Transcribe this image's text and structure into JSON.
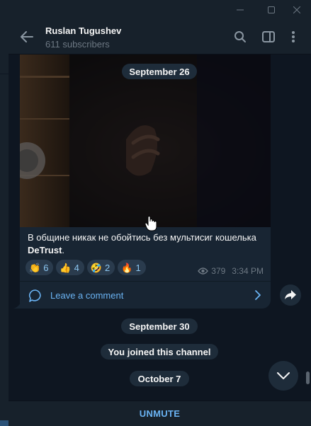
{
  "window": {
    "minimize_icon": "minimize-icon",
    "maximize_icon": "maximize-icon",
    "close_icon": "close-icon"
  },
  "header": {
    "title": "Ruslan Tugushev",
    "subtitle": "611 subscribers",
    "back_icon": "arrow-left-icon",
    "search_icon": "search-icon",
    "sidebar_icon": "sidebar-toggle-icon",
    "more_icon": "more-vertical-icon"
  },
  "chat": {
    "date_top": "September 26",
    "message": {
      "text_main": "В общине никак не обойтись без мультисиг кошелька ",
      "text_bold": "DeTrust",
      "text_end": ".",
      "reactions": [
        {
          "emoji": "👏",
          "count": "6"
        },
        {
          "emoji": "👍",
          "count": "4"
        },
        {
          "emoji": "🤣",
          "count": "2"
        },
        {
          "emoji": "🔥",
          "count": "1"
        }
      ],
      "views": "379",
      "time": "3:34 PM",
      "comment_label": "Leave a comment"
    },
    "service": {
      "date_1": "September 30",
      "joined": "You joined this channel",
      "date_2": "October 7"
    }
  },
  "bottom": {
    "unmute_label": "UNMUTE"
  },
  "colors": {
    "bg": "#0e1621",
    "panel": "#17212b",
    "bubble": "#182533",
    "accent": "#6ab3f3",
    "muted": "#6d7883"
  }
}
